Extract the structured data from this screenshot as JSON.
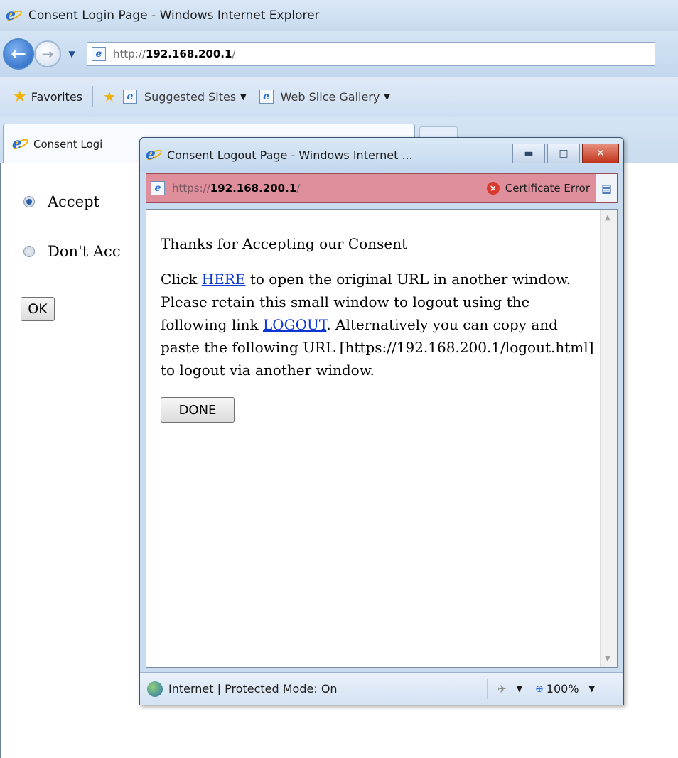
{
  "main_window": {
    "title": "Consent Login Page - Windows Internet Explorer",
    "address": {
      "prefix": "http://",
      "host": "192.168.200.1",
      "suffix": "/"
    },
    "favorites_bar": {
      "favorites_label": "Favorites",
      "items": [
        {
          "label": "Suggested Sites"
        },
        {
          "label": "Web Slice Gallery"
        }
      ]
    },
    "tab": {
      "label": "Consent Logi"
    },
    "page": {
      "options": [
        {
          "label": "Accept",
          "checked": true
        },
        {
          "label": "Don't Acc",
          "checked": false
        }
      ],
      "ok_label": "OK"
    }
  },
  "popup_window": {
    "title": "Consent Logout Page - Windows Internet ...",
    "address": {
      "prefix": "https://",
      "host": "192.168.200.1",
      "suffix": "/"
    },
    "certificate_error": "Certificate Error",
    "content": {
      "heading": "Thanks for Accepting our Consent",
      "p1_before": "Click ",
      "here_link": "HERE",
      "p1_mid": " to open the original URL in another window. Please retain this small window to logout using the following link ",
      "logout_link": "LOGOUT",
      "p1_after": ". Alternatively you can copy and paste the following URL [https://192.168.200.1/logout.html] to logout via another window.",
      "done_label": "DONE"
    },
    "status_bar": {
      "zone": "Internet | Protected Mode: On",
      "zoom": "100%"
    }
  },
  "icons": {
    "ie_logo": "ie-logo-icon",
    "back": "back-arrow-icon",
    "forward": "forward-arrow-icon",
    "favorites_star": "star-icon",
    "certificate_error": "shield-x-icon",
    "globe": "globe-icon"
  }
}
